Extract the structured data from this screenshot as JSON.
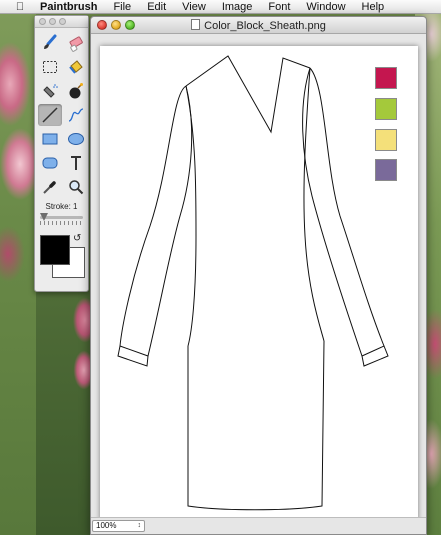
{
  "menubar": {
    "app_name": "Paintbrush",
    "items": [
      "File",
      "Edit",
      "View",
      "Image",
      "Font",
      "Window",
      "Help"
    ]
  },
  "tools_palette": {
    "tools": [
      "paintbrush-icon",
      "eraser-icon",
      "rect-select-icon",
      "fill-bucket-icon",
      "spray-icon",
      "bomb-icon",
      "line-icon",
      "curve-icon",
      "rectangle-icon",
      "ellipse-icon",
      "rounded-rect-icon",
      "text-icon",
      "eyedropper-icon",
      "magnifier-icon"
    ],
    "selected_tool": "line-icon",
    "stroke_label": "Stroke: 1",
    "foreground_color": "#000000",
    "background_color": "#ffffff"
  },
  "window": {
    "title": "Color_Block_Sheath.png",
    "zoom": "100%"
  },
  "canvas": {
    "color_swatches": [
      "#c4164f",
      "#a4c93b",
      "#f4e07a",
      "#7a6a9a"
    ]
  }
}
